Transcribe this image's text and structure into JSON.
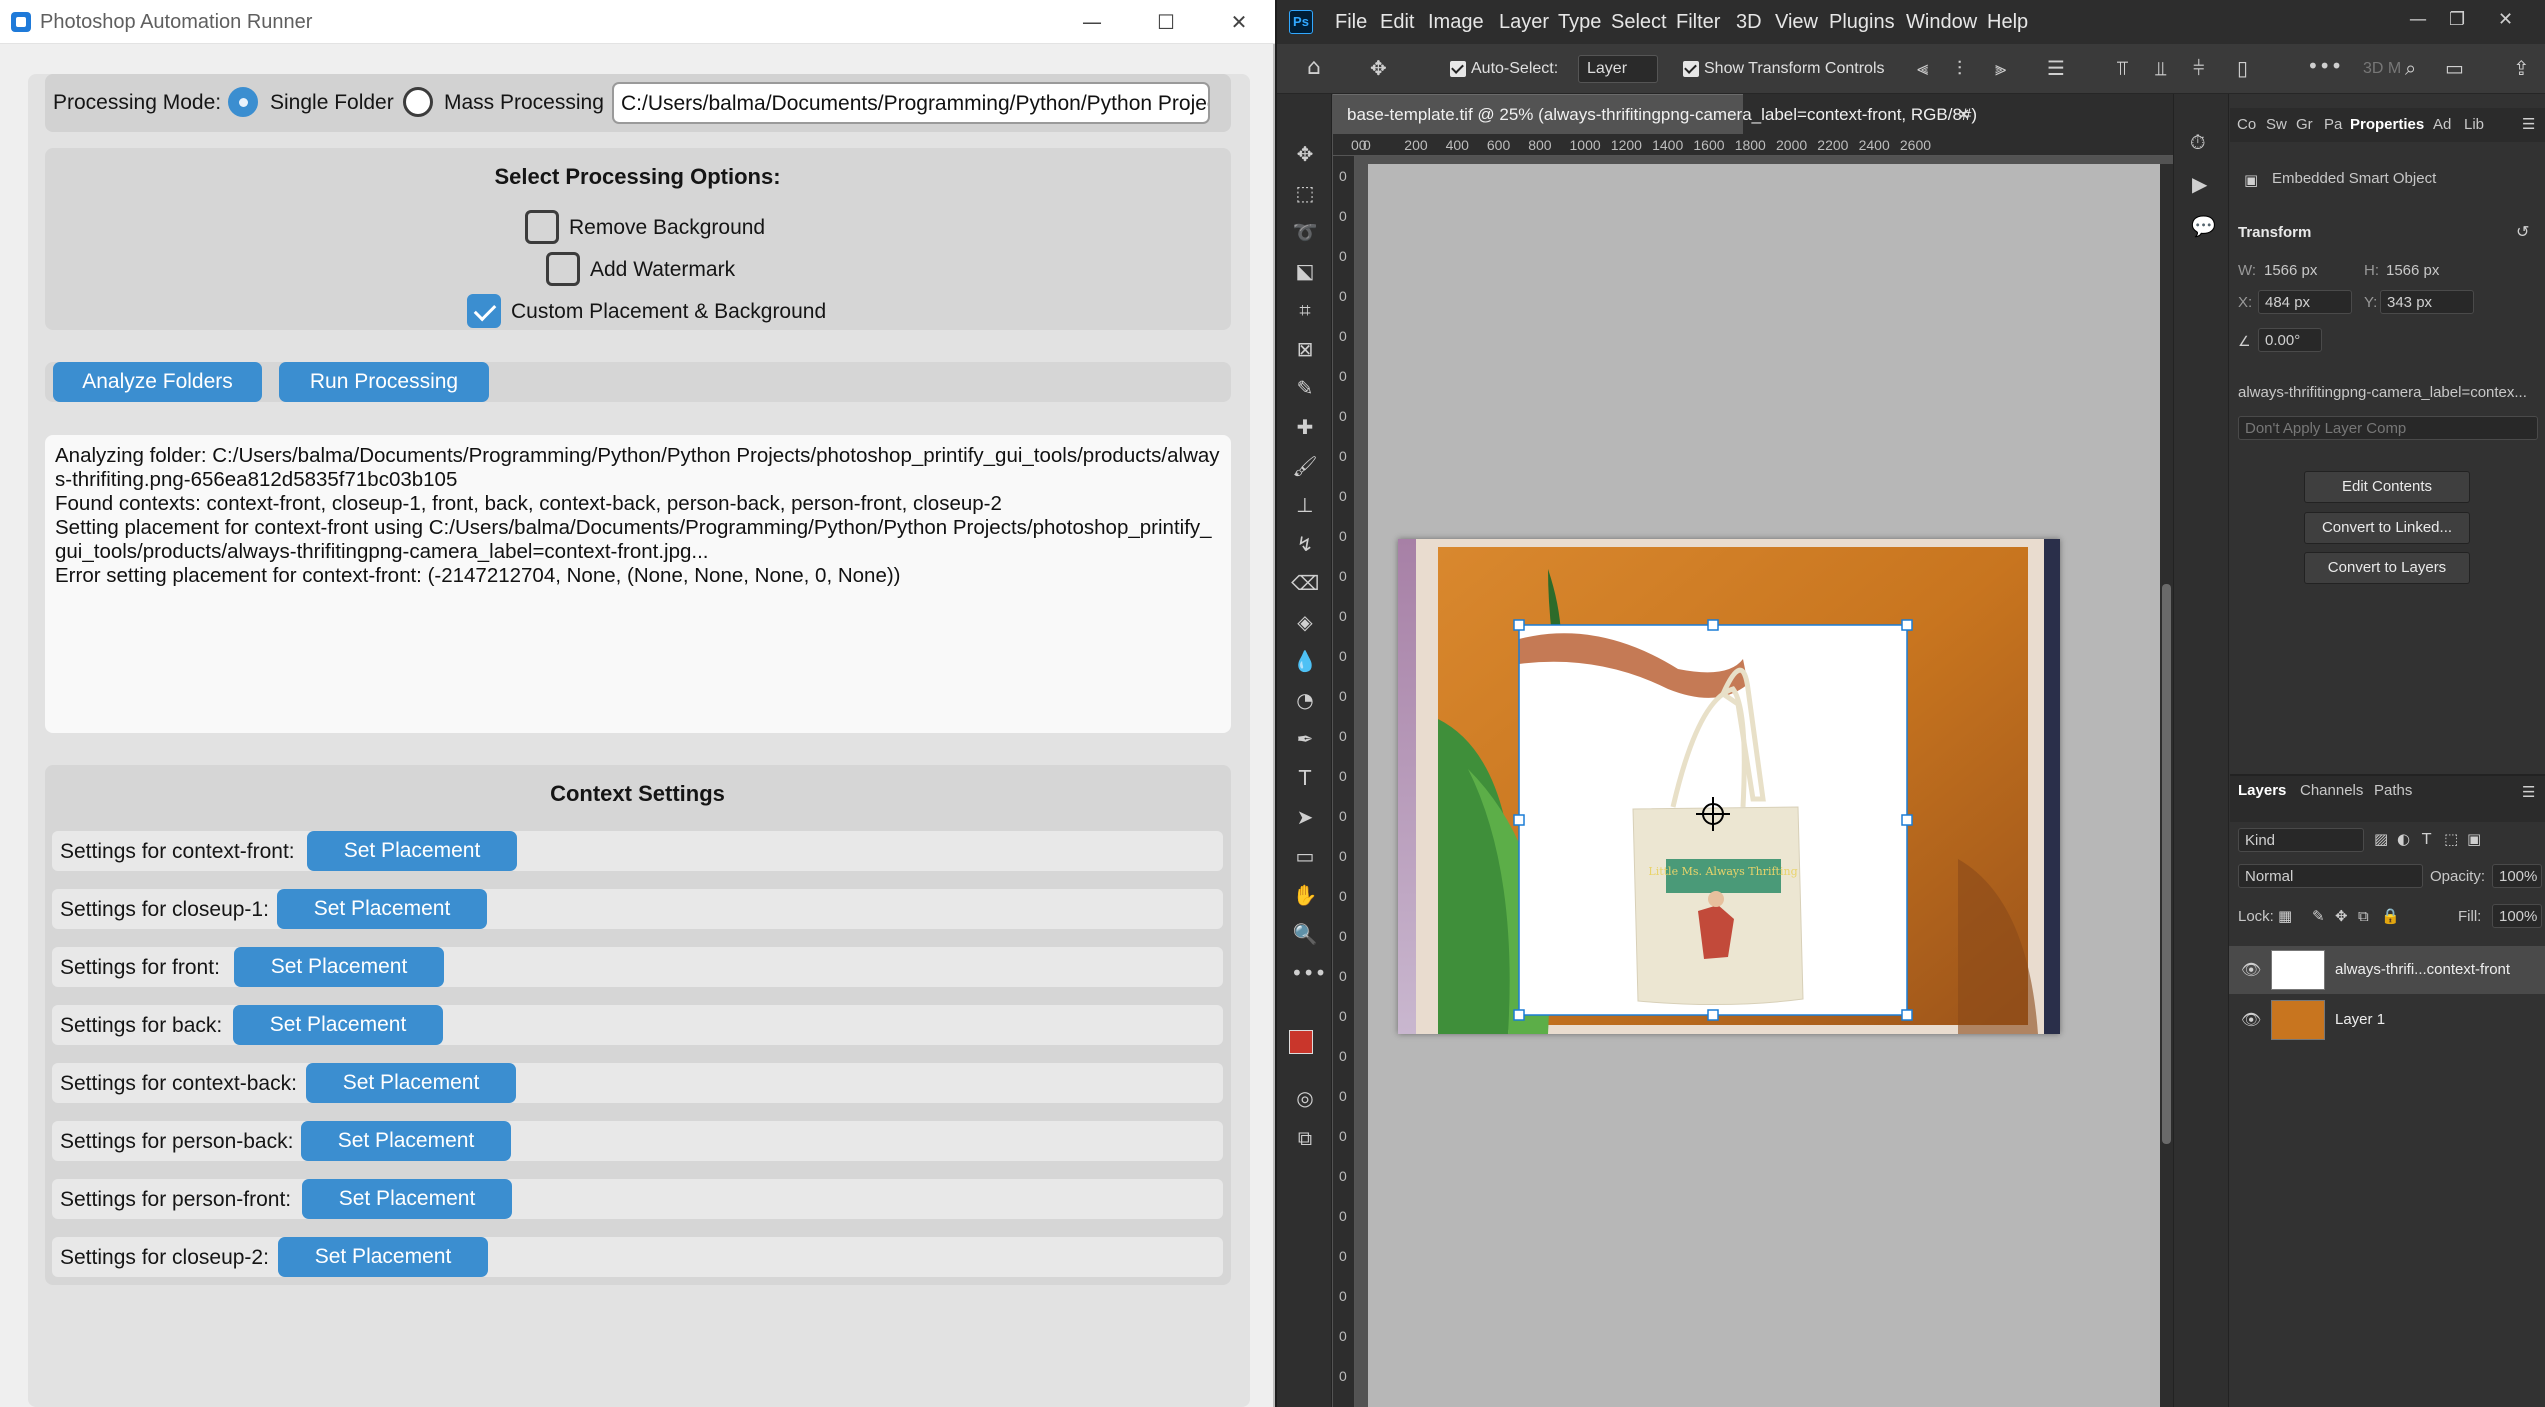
{
  "runner": {
    "title": "Photoshop Automation Runner",
    "window_controls": {
      "minimize": "—",
      "maximize": "☐",
      "close": "✕"
    },
    "mode": {
      "label": "Processing Mode:",
      "options": [
        "Single Folder",
        "Mass Processing"
      ],
      "selected": "Single Folder",
      "path_value": "C:/Users/balma/Documents/Programming/Python/Python Projec"
    },
    "options": {
      "title": "Select Processing Options:",
      "remove_background": {
        "label": "Remove Background",
        "checked": false
      },
      "add_watermark": {
        "label": "Add Watermark",
        "checked": false
      },
      "custom_placement": {
        "label": "Custom Placement & Background",
        "checked": true
      }
    },
    "actions": {
      "analyze": "Analyze Folders",
      "run": "Run Processing"
    },
    "log": [
      "Analyzing folder: C:/Users/balma/Documents/Programming/Python/Python Projects/photoshop_printify_gui_tools/products/alway",
      "s-thrifiting.png-656ea812d5835f71bc03b105",
      "Found contexts: context-front, closeup-1, front, back, context-back, person-back, person-front, closeup-2",
      "Setting placement for context-front using C:/Users/balma/Documents/Programming/Python/Python Projects/photoshop_printify_",
      "gui_tools/products/always-thrifitingpng-camera_label=context-front.jpg...",
      "Error setting placement for context-front: (-2147212704, None, (None, None, None, 0, None))"
    ],
    "context": {
      "title": "Context Settings",
      "button_label": "Set Placement",
      "rows": [
        "Settings for context-front:",
        "Settings for closeup-1:",
        "Settings for front:",
        "Settings for back:",
        "Settings for context-back:",
        "Settings for person-back:",
        "Settings for person-front:",
        "Settings for closeup-2:"
      ]
    }
  },
  "photoshop": {
    "logo": "Ps",
    "menu": [
      "File",
      "Edit",
      "Image",
      "Layer",
      "Type",
      "Select",
      "Filter",
      "3D",
      "View",
      "Plugins",
      "Window",
      "Help"
    ],
    "options_bar": {
      "auto_select_label": "Auto-Select:",
      "auto_select_value": "Layer",
      "show_transform_label": "Show Transform Controls",
      "threed_label": "3D M"
    },
    "document_tab": "base-template.tif @ 25% (always-thrifitingpng-camera_label=context-front, RGB/8#)",
    "ruler_top": [
      "00",
      "0",
      "200",
      "400",
      "600",
      "800",
      "1000",
      "1200",
      "1400",
      "1600",
      "1800",
      "2000",
      "2200",
      "2400",
      "2600"
    ],
    "ruler_left": [
      "0",
      "0",
      "0",
      "0",
      "0",
      "0",
      "0",
      "0",
      "0",
      "0",
      "0",
      "0",
      "0",
      "0",
      "0",
      "0",
      "0",
      "0",
      "0",
      "0",
      "0",
      "0",
      "0",
      "0",
      "0",
      "0",
      "0",
      "0",
      "0",
      "0",
      "0",
      "0"
    ],
    "bag_text": "Little Ms. Always Thrifting",
    "panel_tabs": [
      "Co",
      "Sw",
      "Gr",
      "Pa",
      "Properties",
      "Ad",
      "Lib"
    ],
    "properties": {
      "object_type": "Embedded Smart Object",
      "transform_title": "Transform",
      "w_label": "W:",
      "w_value": "1566 px",
      "h_label": "H:",
      "h_value": "1566 px",
      "x_label": "X:",
      "x_value": "484 px",
      "y_label": "Y:",
      "y_value": "343 px",
      "angle_value": "0.00°",
      "linked_name": "always-thrifitingpng-camera_label=contex...",
      "layer_comp": "Don't Apply Layer Comp",
      "buttons": [
        "Edit Contents",
        "Convert to Linked...",
        "Convert to Layers"
      ]
    },
    "layers_panel": {
      "tabs": [
        "Layers",
        "Channels",
        "Paths"
      ],
      "filter": "Kind",
      "blend_mode": "Normal",
      "opacity_label": "Opacity:",
      "opacity_value": "100%",
      "lock_label": "Lock:",
      "fill_label": "Fill:",
      "fill_value": "100%",
      "layers": [
        "always-thrifi...context-front",
        "Layer 1"
      ]
    },
    "colors": {
      "foreground": "#c9362b",
      "background": "#000000",
      "accent": "#31a8ff"
    }
  }
}
